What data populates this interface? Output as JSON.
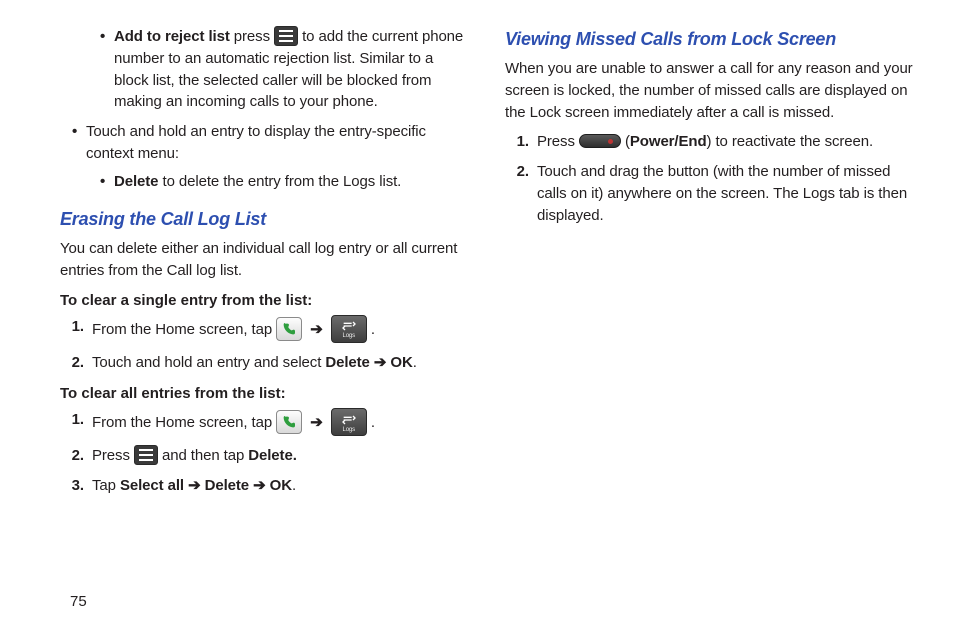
{
  "page_number": "75",
  "col1": {
    "bullet_reject_bold": "Add to reject list",
    "bullet_reject_pre": " press ",
    "bullet_reject_post": " to add the current phone number to an automatic rejection list. Similar to a block list, the selected caller will be blocked from making an incoming calls to your phone.",
    "bullet_context": "Touch and hold an entry to display the entry-specific context menu:",
    "bullet_delete_bold": "Delete",
    "bullet_delete_rest": " to delete the entry from the Logs list.",
    "sec1_title": "Erasing the Call Log List",
    "sec1_intro": "You can delete either an individual call log entry or all current entries from the Call log list.",
    "sub1": "To clear a single entry from the list:",
    "s1_1_pre": "From the Home screen, tap ",
    "s1_1_post": " .",
    "s1_2_pre": "Touch and hold an entry and select ",
    "s1_2_b1": "Delete",
    "s1_2_arrow": " ➔ ",
    "s1_2_b2": "OK",
    "s1_2_post": ".",
    "sub2": "To clear all entries from the list:",
    "s2_1_pre": "From the Home screen, tap ",
    "s2_1_post": " .",
    "s2_2_pre": "Press ",
    "s2_2_mid": " and then tap ",
    "s2_2_b": "Delete.",
    "s2_3_pre": "Tap ",
    "s2_3_b1": "Select all",
    "s2_3_a1": " ➔ ",
    "s2_3_b2": "Delete",
    "s2_3_a2": " ➔ ",
    "s2_3_b3": "OK",
    "s2_3_post": "."
  },
  "col2": {
    "sec2_title": "Viewing Missed Calls from Lock Screen",
    "sec2_intro": "When you are unable to answer a call for any reason and your screen is locked, the number of missed calls are displayed on the Lock screen immediately after a call is missed.",
    "m1_pre": "Press ",
    "m1_mid": " (",
    "m1_b": "Power/End",
    "m1_post": ") to reactivate the screen.",
    "m2": "Touch and drag the button (with the number of missed calls on it) anywhere on the screen. The Logs tab is then displayed."
  },
  "icons": {
    "logs_label": "Logs"
  }
}
